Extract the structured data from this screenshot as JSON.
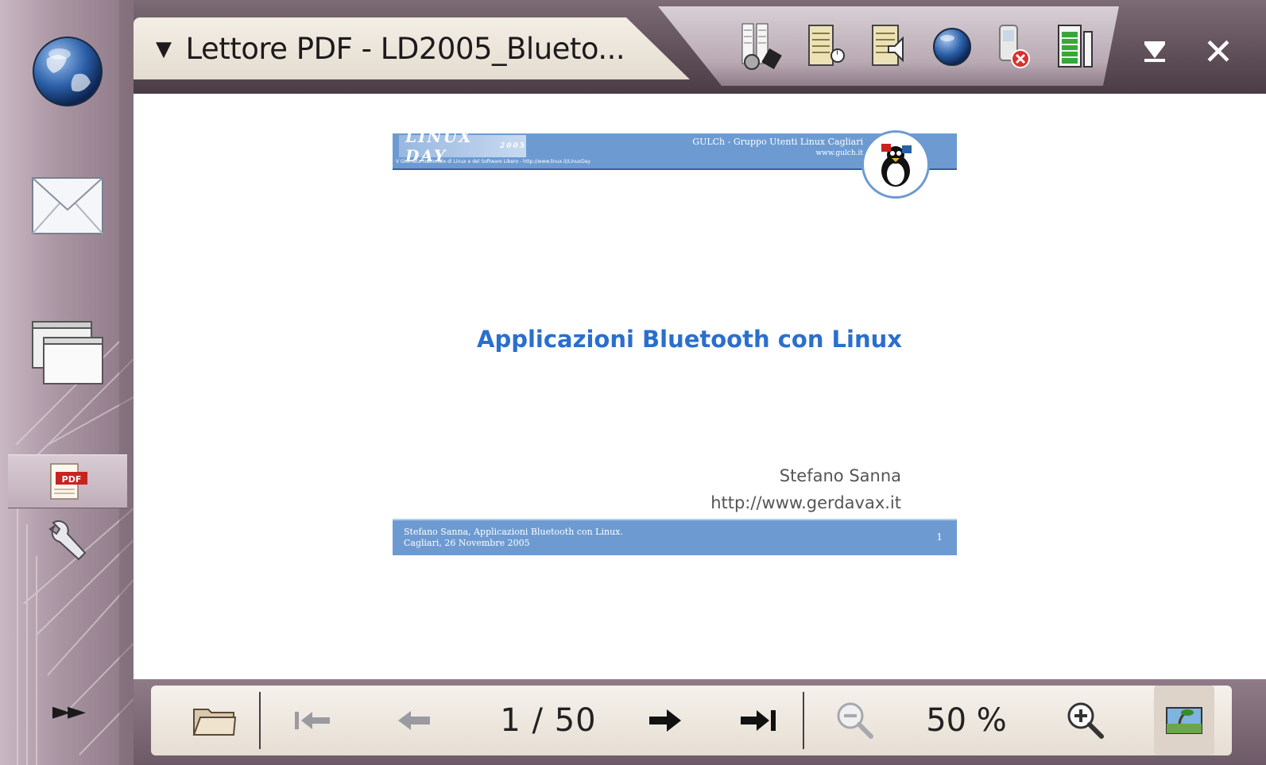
{
  "window": {
    "title": "Lettore PDF - LD2005_Blueto...",
    "menu_arrow": "▼",
    "close_glyph": "✕"
  },
  "sidebar": {
    "items": [
      {
        "name": "web",
        "icon": "globe-icon"
      },
      {
        "name": "mail",
        "icon": "envelope-icon"
      },
      {
        "name": "windows",
        "icon": "windows-icon"
      },
      {
        "name": "pdf-reader",
        "icon": "pdf-icon",
        "active": true,
        "badge": "PDF"
      },
      {
        "name": "tools",
        "icon": "wrench-icon"
      },
      {
        "name": "more",
        "icon": "fast-forward-icon",
        "glyph": "►►"
      }
    ]
  },
  "status_icons": [
    "application-manager-icon",
    "display-brightness-icon",
    "volume-icon",
    "internet-connection-icon",
    "presence-offline-icon",
    "battery-icon"
  ],
  "slide": {
    "logo_text": "LINUX DAY",
    "logo_year": "2005",
    "org": "GULCh - Gruppo Utenti Linux Cagliari",
    "org_url": "www.gulch.it",
    "giornata": "V Giornata Nazionale di Linux e del Software Libero  -  http://www.linux.it/LinuxDay",
    "title": "Applicazioni Bluetooth con Linux",
    "author": "Stefano Sanna",
    "author_url": "http://www.gerdavax.it",
    "footer_line1": "Stefano Sanna, Applicazioni Bluetooth con Linux.",
    "footer_line2": "Cagliari, 26 Novembre 2005",
    "page_number": "1"
  },
  "toolbar": {
    "current_page": "1",
    "separator": "/",
    "total_pages": "50",
    "page_label": "1  / 50",
    "zoom": "50 %"
  },
  "colors": {
    "slide_blue": "#6d9bd1",
    "title_blue": "#2a6fce",
    "chrome": "#8a7681"
  }
}
